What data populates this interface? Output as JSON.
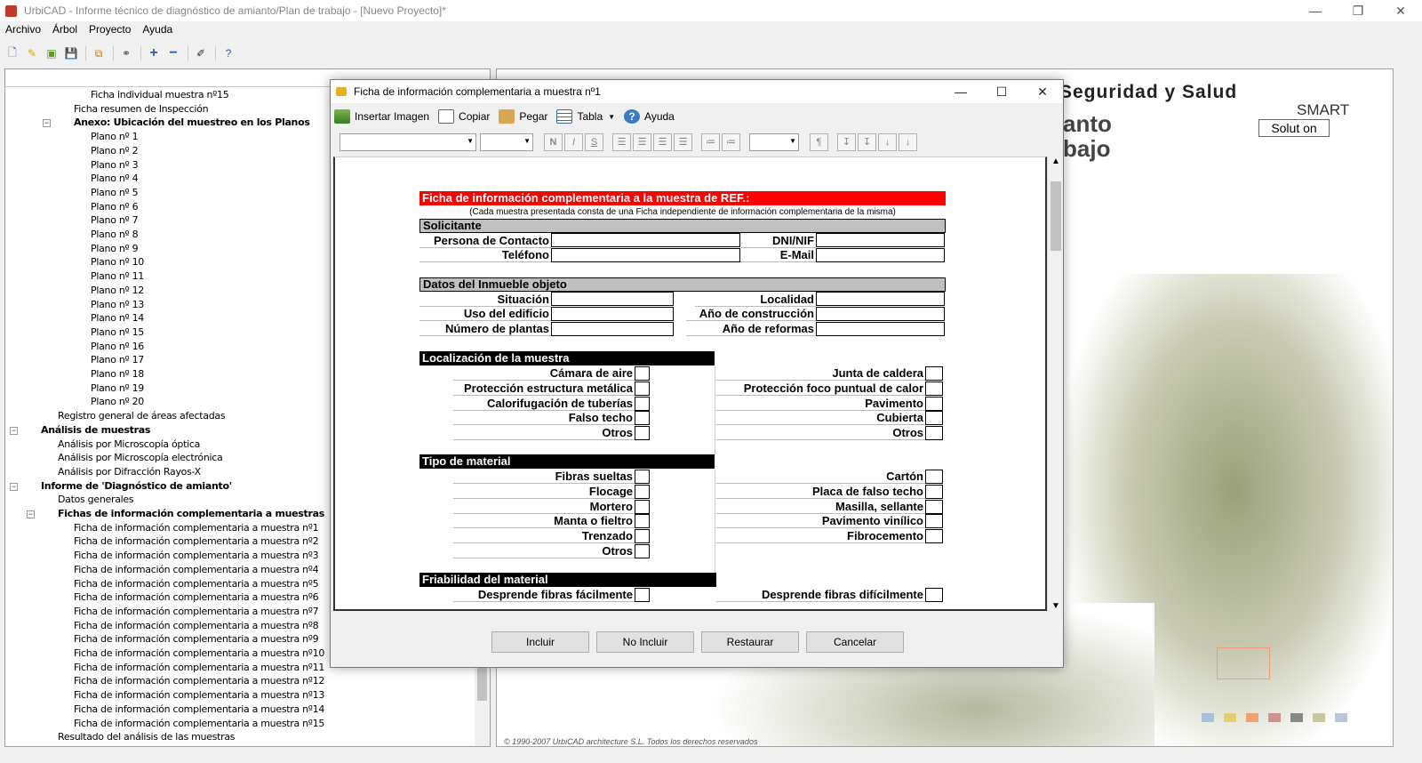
{
  "window": {
    "title": "UrbiCAD - Informe técnico de diagnóstico de amianto/Plan de trabajo - [Nuevo Proyecto]*"
  },
  "menu": [
    "Archivo",
    "Árbol",
    "Proyecto",
    "Ayuda"
  ],
  "tree": {
    "items": [
      {
        "label": "Ficha individual muestra nº15",
        "bold": false
      },
      {
        "label": "Ficha resumen de Inspección",
        "bold": false
      },
      {
        "label": "Anexo: Ubicación del muestreo en los Planos",
        "bold": true
      },
      {
        "label": "Plano nº 1",
        "bold": false
      },
      {
        "label": "Plano nº 2",
        "bold": false
      },
      {
        "label": "Plano nº 3",
        "bold": false
      },
      {
        "label": "Plano nº 4",
        "bold": false
      },
      {
        "label": "Plano nº 5",
        "bold": false
      },
      {
        "label": "Plano nº 6",
        "bold": false
      },
      {
        "label": "Plano nº 7",
        "bold": false
      },
      {
        "label": "Plano nº 8",
        "bold": false
      },
      {
        "label": "Plano nº 9",
        "bold": false
      },
      {
        "label": "Plano nº 10",
        "bold": false
      },
      {
        "label": "Plano nº 11",
        "bold": false
      },
      {
        "label": "Plano nº 12",
        "bold": false
      },
      {
        "label": "Plano nº 13",
        "bold": false
      },
      {
        "label": "Plano nº 14",
        "bold": false
      },
      {
        "label": "Plano nº 15",
        "bold": false
      },
      {
        "label": "Plano nº 16",
        "bold": false
      },
      {
        "label": "Plano nº 17",
        "bold": false
      },
      {
        "label": "Plano nº 18",
        "bold": false
      },
      {
        "label": "Plano nº 19",
        "bold": false
      },
      {
        "label": "Plano nº 20",
        "bold": false
      },
      {
        "label": "Registro general de áreas afectadas",
        "bold": false
      },
      {
        "label": "Análisis de muestras",
        "bold": true
      },
      {
        "label": "Análisis por Microscopía óptica",
        "bold": false
      },
      {
        "label": "Análisis por Microscopía electrónica",
        "bold": false
      },
      {
        "label": "Análisis por Difracción Rayos-X",
        "bold": false
      },
      {
        "label": "Informe de 'Diagnóstico de amianto'",
        "bold": true
      },
      {
        "label": "Datos generales",
        "bold": false
      },
      {
        "label": "Fichas de información complementaria a muestras",
        "bold": true
      },
      {
        "label": "Ficha de información complementaria a muestra nº1",
        "bold": false
      },
      {
        "label": "Ficha de información complementaria a muestra nº2",
        "bold": false
      },
      {
        "label": "Ficha de información complementaria a muestra nº3",
        "bold": false
      },
      {
        "label": "Ficha de información complementaria a muestra nº4",
        "bold": false
      },
      {
        "label": "Ficha de información complementaria a muestra nº5",
        "bold": false
      },
      {
        "label": "Ficha de información complementaria a muestra nº6",
        "bold": false
      },
      {
        "label": "Ficha de información complementaria a muestra nº7",
        "bold": false
      },
      {
        "label": "Ficha de información complementaria a muestra nº8",
        "bold": false
      },
      {
        "label": "Ficha de información complementaria a muestra nº9",
        "bold": false
      },
      {
        "label": "Ficha de información complementaria a muestra nº10",
        "bold": false
      },
      {
        "label": "Ficha de información complementaria a muestra nº11",
        "bold": false
      },
      {
        "label": "Ficha de información complementaria a muestra nº12",
        "bold": false
      },
      {
        "label": "Ficha de información complementaria a muestra nº13",
        "bold": false
      },
      {
        "label": "Ficha de información complementaria a muestra nº14",
        "bold": false
      },
      {
        "label": "Ficha de información complementaria a muestra nº15",
        "bold": false
      },
      {
        "label": "Resultado del análisis de las muestras",
        "bold": false
      }
    ]
  },
  "splash": {
    "line1": "D Seguridad y Salud",
    "line2": "anto",
    "line3": "bajo",
    "smart": "SMART",
    "solution": "Solut on",
    "copyright": "© 1990-2007 UrbiCAD architecture S.L. Todos los derechos reservados"
  },
  "dialog": {
    "title": "Ficha de información complementaria a muestra nº1",
    "toolbar": {
      "insert_image": "Insertar Imagen",
      "copy": "Copiar",
      "paste": "Pegar",
      "table": "Tabla",
      "help": "Ayuda"
    },
    "format": {
      "bold": "N",
      "italic": "I",
      "underline": "S",
      "para": "¶"
    },
    "form": {
      "title": "Ficha de información complementaria a la muestra de REF.:",
      "note": "(Cada muestra presentada consta de una Ficha independiente de información complementaria de la misma)",
      "solicitante": {
        "header": "Solicitante",
        "contact": "Persona de Contacto",
        "dni": "DNI/NIF",
        "phone": "Teléfono",
        "email": "E-Mail"
      },
      "inmueble": {
        "header": "Datos del Inmueble objeto",
        "situacion": "Situación",
        "localidad": "Localidad",
        "uso": "Uso del edificio",
        "anio_construccion": "Año de construcción",
        "plantas": "Número de plantas",
        "anio_reformas": "Año de reformas"
      },
      "localizacion": {
        "header": "Localización de la muestra",
        "left": [
          "Cámara de aire",
          "Protección estructura metálica",
          "Calorifugación de tuberías",
          "Falso techo",
          "Otros"
        ],
        "right": [
          "Junta de caldera",
          "Protección foco puntual de calor",
          "Pavimento",
          "Cubierta",
          "Otros"
        ]
      },
      "material": {
        "header": "Tipo de material",
        "left": [
          "Fibras sueltas",
          "Flocage",
          "Mortero",
          "Manta o fieltro",
          "Trenzado",
          "Otros"
        ],
        "right": [
          "Cartón",
          "Placa de falso techo",
          "Masilla, sellante",
          "Pavimento vinílico",
          "Fibrocemento"
        ]
      },
      "friabilidad": {
        "header": "Friabilidad del material",
        "left": "Desprende fibras fácilmente",
        "right": "Desprende fibras difícilmente"
      }
    },
    "buttons": {
      "include": "Incluir",
      "exclude": "No Incluir",
      "restore": "Restaurar",
      "cancel": "Cancelar"
    }
  }
}
